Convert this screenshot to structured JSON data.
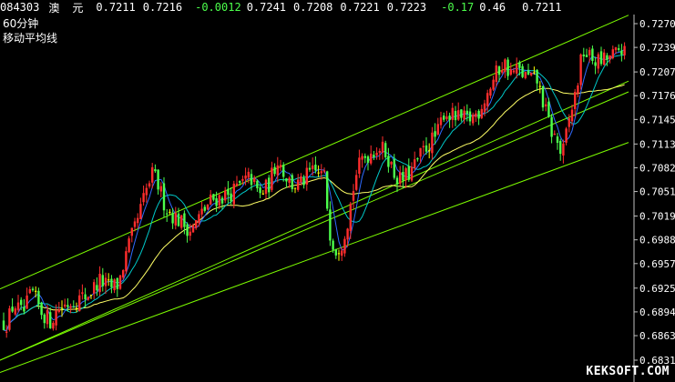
{
  "quote_bar": {
    "code": "084303",
    "name_1": "澳",
    "name_2": "元",
    "last": "0.7211",
    "open": "0.7216",
    "change": "-0.0012",
    "high": "0.7241",
    "low": "0.7208",
    "bid": "0.7221",
    "ask": "0.7223",
    "change_pct": "-0.17",
    "amplitude": "0.46",
    "close": "0.7211"
  },
  "chart_labels": {
    "period": "60分钟",
    "indicator": "移动平均线"
  },
  "watermark": "KEKSOFT.COM",
  "chart_data": {
    "type": "candlestick",
    "y_ticks": [
      "0.7270",
      "0.7239",
      "0.7207",
      "0.7176",
      "0.7145",
      "0.7113",
      "0.7082",
      "0.7051",
      "0.7019",
      "0.6988",
      "0.6957",
      "0.6925",
      "0.6894",
      "0.6863",
      "0.6831"
    ],
    "ylim": [
      0.6831,
      0.727
    ],
    "colors": {
      "up": "#ff2d2d",
      "down": "#4cff4c",
      "doji": "#ffff00",
      "ma_short": "#2f6bff",
      "ma_mid": "#00c8c8",
      "ma_long": "#ffff66",
      "channel": "#7cfc00",
      "axis": "#c0c0c0"
    },
    "channel_lines": [
      {
        "name": "upper",
        "y_start": 0.6924,
        "y_end": 0.7281
      },
      {
        "name": "middle",
        "y_start": 0.6831,
        "y_end": 0.7181
      },
      {
        "name": "lower",
        "y_start": 0.6815,
        "y_end": 0.7115
      },
      {
        "name": "lower-outer",
        "y_start": 0.6831,
        "y_end": 0.7195
      }
    ],
    "price_path": [
      [
        0,
        0.688
      ],
      [
        8,
        0.688
      ],
      [
        15,
        0.6905
      ],
      [
        25,
        0.689
      ],
      [
        35,
        0.692
      ],
      [
        45,
        0.6895
      ],
      [
        55,
        0.6882
      ],
      [
        65,
        0.69
      ],
      [
        80,
        0.6908
      ],
      [
        95,
        0.6915
      ],
      [
        110,
        0.6935
      ],
      [
        120,
        0.6925
      ],
      [
        130,
        0.693
      ],
      [
        140,
        0.6975
      ],
      [
        150,
        0.701
      ],
      [
        160,
        0.705
      ],
      [
        168,
        0.7075
      ],
      [
        175,
        0.7055
      ],
      [
        182,
        0.703
      ],
      [
        190,
        0.702
      ],
      [
        200,
        0.701
      ],
      [
        210,
        0.7
      ],
      [
        220,
        0.702
      ],
      [
        232,
        0.704
      ],
      [
        245,
        0.7045
      ],
      [
        255,
        0.705
      ],
      [
        265,
        0.706
      ],
      [
        275,
        0.707
      ],
      [
        285,
        0.7045
      ],
      [
        295,
        0.706
      ],
      [
        305,
        0.7095
      ],
      [
        312,
        0.7075
      ],
      [
        320,
        0.706
      ],
      [
        330,
        0.706
      ],
      [
        340,
        0.7075
      ],
      [
        350,
        0.7075
      ],
      [
        356,
        0.707
      ],
      [
        362,
        0.7
      ],
      [
        368,
        0.6975
      ],
      [
        375,
        0.6985
      ],
      [
        382,
        0.7015
      ],
      [
        390,
        0.707
      ],
      [
        398,
        0.7095
      ],
      [
        405,
        0.71
      ],
      [
        415,
        0.711
      ],
      [
        425,
        0.71
      ],
      [
        432,
        0.7075
      ],
      [
        440,
        0.7065
      ],
      [
        450,
        0.7075
      ],
      [
        458,
        0.709
      ],
      [
        465,
        0.7105
      ],
      [
        472,
        0.7115
      ],
      [
        480,
        0.7125
      ],
      [
        487,
        0.7155
      ],
      [
        495,
        0.715
      ],
      [
        505,
        0.7145
      ],
      [
        515,
        0.7145
      ],
      [
        525,
        0.7155
      ],
      [
        535,
        0.718
      ],
      [
        545,
        0.7205
      ],
      [
        553,
        0.722
      ],
      [
        560,
        0.7205
      ],
      [
        568,
        0.721
      ],
      [
        578,
        0.72
      ],
      [
        590,
        0.7195
      ],
      [
        598,
        0.716
      ],
      [
        605,
        0.713
      ],
      [
        612,
        0.7115
      ],
      [
        617,
        0.7095
      ],
      [
        624,
        0.714
      ],
      [
        632,
        0.718
      ],
      [
        640,
        0.7235
      ],
      [
        648,
        0.7225
      ],
      [
        658,
        0.722
      ],
      [
        668,
        0.7225
      ],
      [
        676,
        0.723
      ],
      [
        682,
        0.724
      ],
      [
        688,
        0.7222
      ]
    ]
  }
}
